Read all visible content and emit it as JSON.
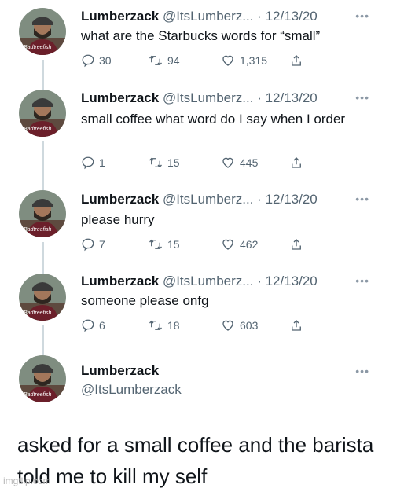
{
  "tweets": [
    {
      "name": "Lumberzack",
      "handle": "@ItsLumberz...",
      "date": "· 12/13/20",
      "more": "•••",
      "text": "what are the Starbucks words for “small”",
      "replies": "30",
      "retweets": "94",
      "likes": "1,315"
    },
    {
      "name": "Lumberzack",
      "handle": "@ItsLumberz...",
      "date": "· 12/13/20",
      "more": "•••",
      "text": "small coffee what word do I say when I order",
      "replies": "1",
      "retweets": "15",
      "likes": "445"
    },
    {
      "name": "Lumberzack",
      "handle": "@ItsLumberz...",
      "date": "· 12/13/20",
      "more": "•••",
      "text": "please hurry",
      "replies": "7",
      "retweets": "15",
      "likes": "462"
    },
    {
      "name": "Lumberzack",
      "handle": "@ItsLumberz...",
      "date": "· 12/13/20",
      "more": "•••",
      "text": "someone please onfg",
      "replies": "6",
      "retweets": "18",
      "likes": "603"
    }
  ],
  "final": {
    "name": "Lumberzack",
    "handle": "@ItsLumberzack",
    "more": "•••"
  },
  "avatar_text": "Badtreefish",
  "caption": "asked for a small coffee and the barista told me to kill my self",
  "watermark": "imgflip.com",
  "colors": {
    "text": "#0f1419",
    "muted": "#536471",
    "line": "#cfd9de"
  },
  "icons": [
    "reply-icon",
    "retweet-icon",
    "like-icon",
    "share-icon",
    "more-icon"
  ]
}
